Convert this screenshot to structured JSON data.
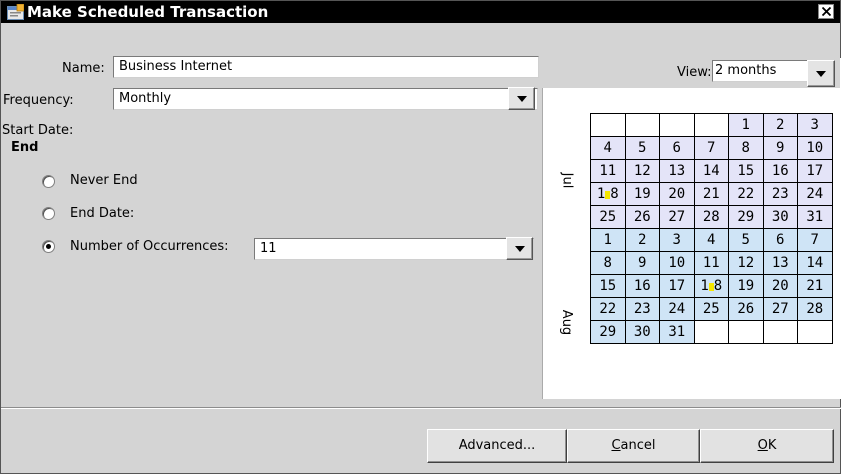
{
  "window": {
    "title": "Make Scheduled Transaction"
  },
  "form": {
    "name_label": "Name:",
    "name_value": "Business Internet",
    "frequency_label": "Frequency:",
    "frequency_value": "Monthly",
    "start_date_label": "Start Date:",
    "end_heading": "End",
    "never_end_label": "Never End",
    "end_date_label": "End Date:",
    "occurrences_label": "Number of Occurrences:",
    "occurrences_value": "11",
    "selected_end_option": "Number of Occurrences"
  },
  "calendar": {
    "view_label": "View:",
    "view_value": "2 months",
    "months": [
      {
        "label": "Jul",
        "weeks": [
          [
            "",
            "",
            "",
            "",
            "1",
            "2",
            "3"
          ],
          [
            "4",
            "5",
            "6",
            "7",
            "8",
            "9",
            "10"
          ],
          [
            "11",
            "12",
            "13",
            "14",
            "15",
            "16",
            "17"
          ],
          [
            "18",
            "19",
            "20",
            "21",
            "22",
            "23",
            "24"
          ],
          [
            "25",
            "26",
            "27",
            "28",
            "29",
            "30",
            "31"
          ]
        ]
      },
      {
        "label": "Aug",
        "weeks": [
          [
            "1",
            "2",
            "3",
            "4",
            "5",
            "6",
            "7"
          ],
          [
            "8",
            "9",
            "10",
            "11",
            "12",
            "13",
            "14"
          ],
          [
            "15",
            "16",
            "17",
            "18",
            "19",
            "20",
            "21"
          ],
          [
            "22",
            "23",
            "24",
            "25",
            "26",
            "27",
            "28"
          ],
          [
            "29",
            "30",
            "31",
            "",
            "",
            "",
            ""
          ]
        ]
      }
    ],
    "marked_days": [
      {
        "month": "Jul",
        "day": "18"
      },
      {
        "month": "Aug",
        "day": "18"
      }
    ],
    "colors": {
      "jul": "#e4e4f8",
      "aug": "#cfe4f6",
      "marker": "#f5e600"
    }
  },
  "buttons": {
    "advanced": "Advanced...",
    "cancel_prefix": "C",
    "cancel_rest": "ancel",
    "ok_prefix": "O",
    "ok_rest": "K"
  }
}
